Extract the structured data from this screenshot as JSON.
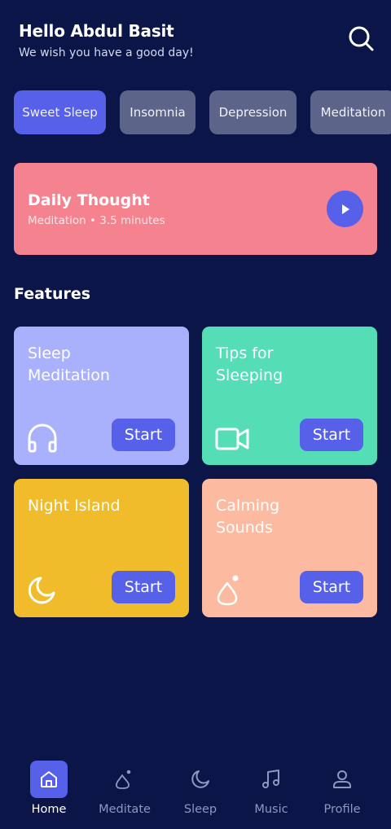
{
  "header": {
    "title": "Hello Abdul Basit",
    "subtitle": "We wish you have a good day!",
    "search_icon": "search-icon"
  },
  "categories": [
    {
      "label": "Sweet Sleep",
      "active": true
    },
    {
      "label": "Insomnia",
      "active": false
    },
    {
      "label": "Depression",
      "active": false
    },
    {
      "label": "Meditation",
      "active": false
    }
  ],
  "daily_thought": {
    "title": "Daily Thought",
    "subtitle": "Meditation • 3.5 minutes",
    "icon": "play-icon"
  },
  "features": {
    "title": "Features",
    "cards": [
      {
        "title": "Sleep Meditation",
        "icon": "headphones-icon",
        "button": "Start",
        "color": "#aab1fc"
      },
      {
        "title": "Tips for Sleeping",
        "icon": "video-camera-icon",
        "button": "Start",
        "color": "#55deb6"
      },
      {
        "title": "Night Island",
        "icon": "moon-icon",
        "button": "Start",
        "color": "#f0bc2b"
      },
      {
        "title": "Calming Sounds",
        "icon": "drop-icon",
        "button": "Start",
        "color": "#fcbaa0"
      }
    ]
  },
  "bottom_nav": [
    {
      "label": "Home",
      "icon": "home-icon",
      "active": true
    },
    {
      "label": "Meditate",
      "icon": "meditate-icon",
      "active": false
    },
    {
      "label": "Sleep",
      "icon": "moon-icon",
      "active": false
    },
    {
      "label": "Music",
      "icon": "music-note-icon",
      "active": false
    },
    {
      "label": "Profile",
      "icon": "user-icon",
      "active": false
    }
  ],
  "colors": {
    "background": "#0b1548",
    "accent": "#5660e8",
    "chip_inactive": "#5c6489",
    "daily_card": "#f4838f",
    "nav_inactive": "#8f98bf"
  }
}
